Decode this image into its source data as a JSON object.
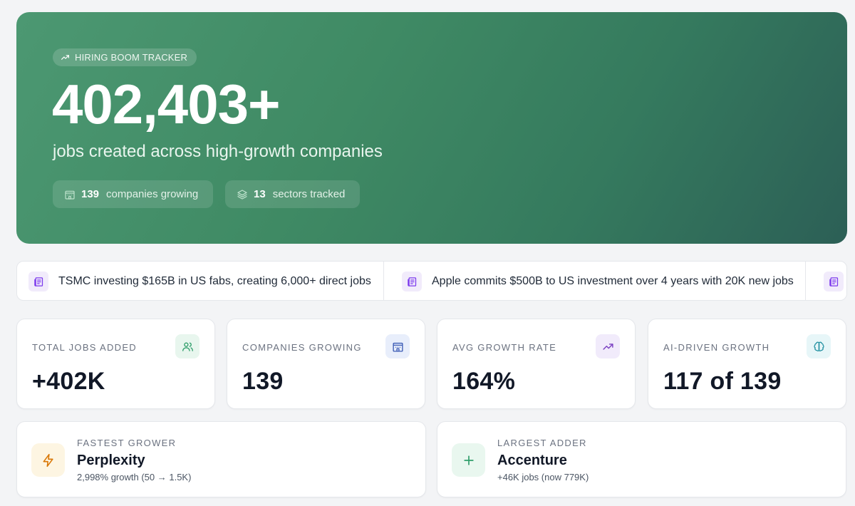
{
  "hero": {
    "badge": "HIRING BOOM TRACKER",
    "badge_icon": "trending-up-icon",
    "total": "402,403+",
    "subtitle": "jobs created across high-growth companies",
    "pills": [
      {
        "icon": "building-icon",
        "value": "139",
        "label": "companies growing"
      },
      {
        "icon": "layers-icon",
        "value": "13",
        "label": "sectors tracked"
      }
    ]
  },
  "ticker": {
    "items": [
      {
        "icon": "newspaper-icon",
        "text": "TSMC investing $165B in US fabs, creating 6,000+ direct jobs"
      },
      {
        "icon": "newspaper-icon",
        "text": "Apple commits $500B to US investment over 4 years with 20K new jobs"
      }
    ]
  },
  "stats": [
    {
      "label": "TOTAL JOBS ADDED",
      "value": "+402K",
      "icon": "users-icon",
      "accent": "#2f9e6a"
    },
    {
      "label": "COMPANIES GROWING",
      "value": "139",
      "icon": "building-icon",
      "accent": "#3b5bb5"
    },
    {
      "label": "AVG GROWTH RATE",
      "value": "164%",
      "icon": "trending-up-icon",
      "accent": "#7a3fc2"
    },
    {
      "label": "AI-DRIVEN GROWTH",
      "value": "117 of 139",
      "icon": "brain-icon",
      "accent": "#1f8fa0"
    }
  ],
  "highlights": [
    {
      "label": "FASTEST GROWER",
      "name": "Perplexity",
      "detail": "2,998% growth (50 → 1.5K)",
      "icon": "lightning-icon",
      "accent": "#d97706"
    },
    {
      "label": "LARGEST ADDER",
      "name": "Accenture",
      "detail": "+46K jobs (now 779K)",
      "icon": "plus-icon",
      "accent": "#2f9e6a"
    }
  ],
  "colors": {
    "hero_start": "#4c9872",
    "hero_end": "#2c5f56",
    "news_icon_bg": "#f1ebfb",
    "news_icon": "#7c3aed"
  }
}
